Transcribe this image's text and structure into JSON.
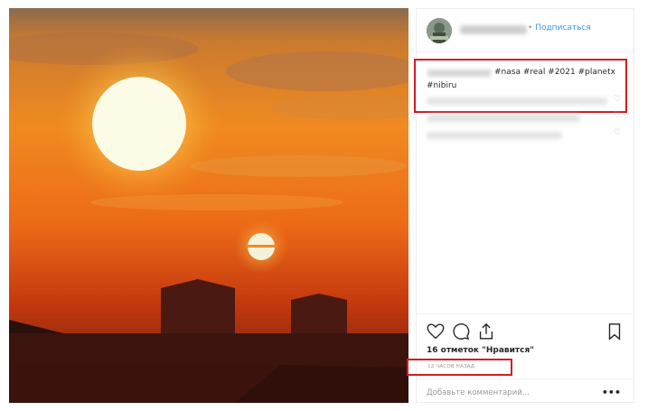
{
  "post": {
    "photo": {
      "alt_icon": "sunset-photo"
    },
    "header": {
      "follow_label": "Подписаться",
      "follow_separator": "•"
    },
    "caption": {
      "line1": "#nasa #real #2021 #planetx",
      "line2": "#nibiru"
    },
    "comment_heart": "♡",
    "likes_text": "16 отметок \"Нравится\"",
    "time_text": "12 ЧАСОВ НАЗАД",
    "add_comment_placeholder": "Добавьте комментарий...",
    "more_label": "•••"
  },
  "colors": {
    "accent": "#3897f0",
    "highlight_box": "#d51b24",
    "sky_top": "#e8751d",
    "sky_bottom": "#c73a0c"
  }
}
